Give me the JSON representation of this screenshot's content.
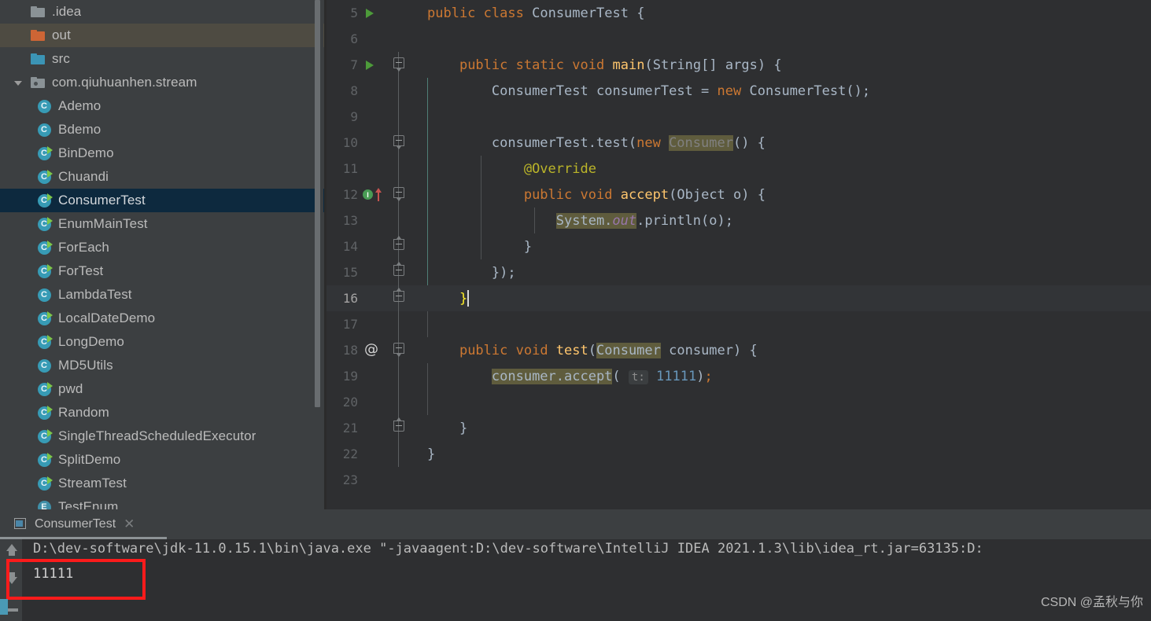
{
  "sidebar": {
    "items": [
      {
        "label": ".idea",
        "icon": "folder-gray-icon",
        "indent": 0,
        "state": "normal",
        "expandable": false
      },
      {
        "label": "out",
        "icon": "folder-orange-icon",
        "indent": 0,
        "state": "hovered",
        "expandable": false
      },
      {
        "label": "src",
        "icon": "folder-blue-icon",
        "indent": 0,
        "state": "normal",
        "expandable": false
      },
      {
        "label": "com.qiuhuanhen.stream",
        "icon": "package-icon",
        "indent": 0,
        "state": "normal",
        "expandable": true
      },
      {
        "label": "Ademo",
        "icon": "java-class-icon",
        "indent": 1,
        "state": "normal",
        "expandable": false
      },
      {
        "label": "Bdemo",
        "icon": "java-class-icon",
        "indent": 1,
        "state": "normal",
        "expandable": false
      },
      {
        "label": "BinDemo",
        "icon": "java-class-runnable-icon",
        "indent": 1,
        "state": "normal",
        "expandable": false
      },
      {
        "label": "Chuandi",
        "icon": "java-class-runnable-icon",
        "indent": 1,
        "state": "normal",
        "expandable": false
      },
      {
        "label": "ConsumerTest",
        "icon": "java-class-runnable-icon",
        "indent": 1,
        "state": "selected",
        "expandable": false
      },
      {
        "label": "EnumMainTest",
        "icon": "java-class-runnable-icon",
        "indent": 1,
        "state": "normal",
        "expandable": false
      },
      {
        "label": "ForEach",
        "icon": "java-class-runnable-icon",
        "indent": 1,
        "state": "normal",
        "expandable": false
      },
      {
        "label": "ForTest",
        "icon": "java-class-runnable-icon",
        "indent": 1,
        "state": "normal",
        "expandable": false
      },
      {
        "label": "LambdaTest",
        "icon": "java-class-icon",
        "indent": 1,
        "state": "normal",
        "expandable": false
      },
      {
        "label": "LocalDateDemo",
        "icon": "java-class-runnable-icon",
        "indent": 1,
        "state": "normal",
        "expandable": false
      },
      {
        "label": "LongDemo",
        "icon": "java-class-runnable-icon",
        "indent": 1,
        "state": "normal",
        "expandable": false
      },
      {
        "label": "MD5Utils",
        "icon": "java-class-icon",
        "indent": 1,
        "state": "normal",
        "expandable": false
      },
      {
        "label": "pwd",
        "icon": "java-class-runnable-icon",
        "indent": 1,
        "state": "normal",
        "expandable": false
      },
      {
        "label": "Random",
        "icon": "java-class-runnable-icon",
        "indent": 1,
        "state": "normal",
        "expandable": false
      },
      {
        "label": "SingleThreadScheduledExecutor",
        "icon": "java-class-runnable-icon",
        "indent": 1,
        "state": "normal",
        "expandable": false
      },
      {
        "label": "SplitDemo",
        "icon": "java-class-runnable-icon",
        "indent": 1,
        "state": "normal",
        "expandable": false
      },
      {
        "label": "StreamTest",
        "icon": "java-class-runnable-icon",
        "indent": 1,
        "state": "normal",
        "expandable": false
      },
      {
        "label": "TestEnum",
        "icon": "java-enum-icon",
        "indent": 1,
        "state": "normal",
        "expandable": false
      }
    ]
  },
  "editor": {
    "file": "ConsumerTest.java",
    "first_line_number": 5,
    "current_line": 16,
    "lines": [
      {
        "n": 5,
        "gutter": "run-arrow",
        "fold": "none",
        "text": "public class ConsumerTest {"
      },
      {
        "n": 6,
        "gutter": "none",
        "fold": "none",
        "text": ""
      },
      {
        "n": 7,
        "gutter": "run-arrow",
        "fold": "fold-start",
        "text": "    public static void main(String[] args) {"
      },
      {
        "n": 8,
        "gutter": "none",
        "fold": "line",
        "text": "        ConsumerTest consumerTest = new ConsumerTest();"
      },
      {
        "n": 9,
        "gutter": "none",
        "fold": "line",
        "text": ""
      },
      {
        "n": 10,
        "gutter": "none",
        "fold": "fold-start",
        "text": "        consumerTest.test(new Consumer() {"
      },
      {
        "n": 11,
        "gutter": "none",
        "fold": "line",
        "text": "            @Override"
      },
      {
        "n": 12,
        "gutter": "override-marker",
        "fold": "fold-start",
        "text": "            public void accept(Object o) {"
      },
      {
        "n": 13,
        "gutter": "none",
        "fold": "line",
        "text": "                System.out.println(o);"
      },
      {
        "n": 14,
        "gutter": "none",
        "fold": "fold-end",
        "text": "            }"
      },
      {
        "n": 15,
        "gutter": "none",
        "fold": "fold-end",
        "text": "        });"
      },
      {
        "n": 16,
        "gutter": "none",
        "fold": "fold-end",
        "text": "    }"
      },
      {
        "n": 17,
        "gutter": "none",
        "fold": "line",
        "text": ""
      },
      {
        "n": 18,
        "gutter": "at-annotation",
        "fold": "fold-start",
        "text": "    public void test(Consumer consumer) {"
      },
      {
        "n": 19,
        "gutter": "none",
        "fold": "line",
        "text": "        consumer.accept( t: 11111);"
      },
      {
        "n": 20,
        "gutter": "none",
        "fold": "line",
        "text": ""
      },
      {
        "n": 21,
        "gutter": "none",
        "fold": "fold-end",
        "text": "    }"
      },
      {
        "n": 22,
        "gutter": "none",
        "fold": "line",
        "text": "}"
      },
      {
        "n": 23,
        "gutter": "none",
        "fold": "none",
        "text": ""
      }
    ],
    "parameter_hint": "t:",
    "highlighted_identifier": "Consumer",
    "caret_line": 16,
    "colors": {
      "background": "#2e2f31",
      "current_line": "#323437",
      "keyword": "#cc7832",
      "string": "#6a8759",
      "number": "#6897bb",
      "method": "#ffc66d",
      "annotation": "#bbb529",
      "field_static": "#9876aa",
      "default_text": "#a9b7c6",
      "identifier_highlight": "#5f5c3d",
      "brace_match": "#ffef28",
      "line_number": "#606366"
    }
  },
  "run_panel": {
    "tab_label": "ConsumerTest",
    "tab_icon": "run-window-icon",
    "close_icon": "close-icon",
    "scroll_up_icon": "scroll-up-icon",
    "scroll_down_icon": "scroll-down-icon",
    "console_command": "D:\\dev-software\\jdk-11.0.15.1\\bin\\java.exe \"-javaagent:D:\\dev-software\\IntelliJ IDEA 2021.1.3\\lib\\idea_rt.jar=63135:D:",
    "console_output": "11111",
    "highlight_color": "#fb1b1b"
  },
  "watermark": {
    "text": "CSDN @孟秋与你"
  }
}
